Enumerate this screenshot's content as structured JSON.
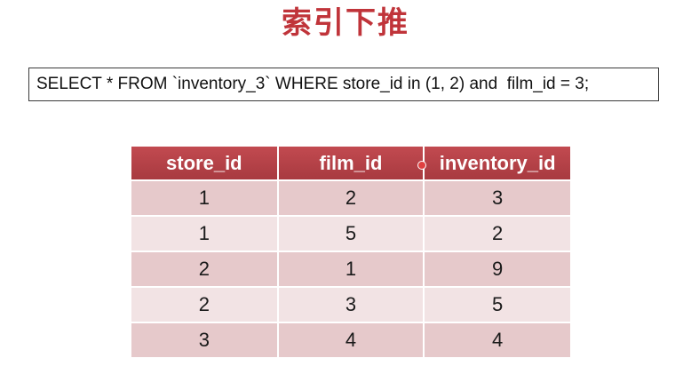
{
  "title": "索引下推",
  "sql": "SELECT * FROM `inventory_3` WHERE store_id in (1, 2) and  film_id = 3;",
  "table": {
    "headers": [
      "store_id",
      "film_id",
      "inventory_id"
    ],
    "rows": [
      [
        "1",
        "2",
        "3"
      ],
      [
        "1",
        "5",
        "2"
      ],
      [
        "2",
        "1",
        "9"
      ],
      [
        "2",
        "3",
        "5"
      ],
      [
        "3",
        "4",
        "4"
      ]
    ]
  },
  "colors": {
    "title": "#c0343a",
    "header_bg": "#b8444a",
    "row_odd": "#e6c9cb",
    "row_even": "#f2e3e4"
  }
}
